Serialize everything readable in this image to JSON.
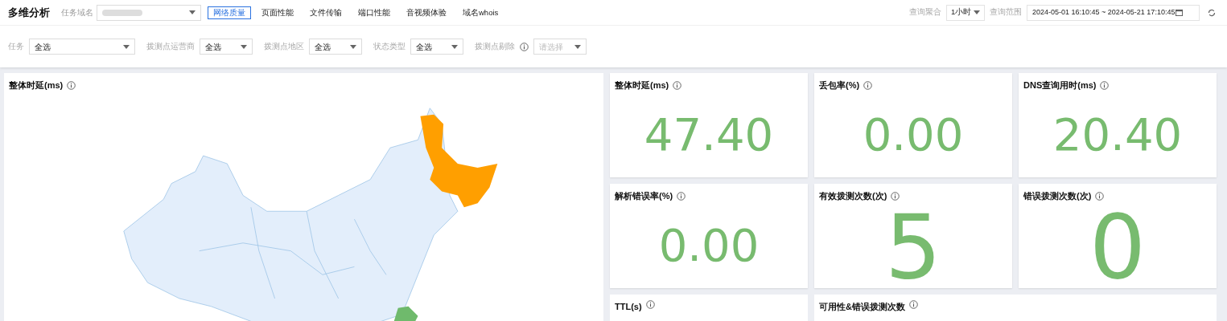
{
  "header": {
    "title": "多维分析",
    "domain_label": "任务域名",
    "tabs": [
      {
        "label": "网络质量",
        "selected": true
      },
      {
        "label": "页面性能",
        "selected": false
      },
      {
        "label": "文件传输",
        "selected": false
      },
      {
        "label": "端口性能",
        "selected": false
      },
      {
        "label": "音视频体验",
        "selected": false
      },
      {
        "label": "域名whois",
        "selected": false
      }
    ],
    "aggregate_label": "查询聚合",
    "aggregate_value": "1小时",
    "range_label": "查询范围",
    "range_value": "2024-05-01 16:10:45 ~ 2024-05-21 17:10:45"
  },
  "filters": [
    {
      "label": "任务",
      "value": "全选",
      "info": false
    },
    {
      "label": "拨测点运营商",
      "value": "全选",
      "info": false
    },
    {
      "label": "拨测点地区",
      "value": "全选",
      "info": false
    },
    {
      "label": "状态类型",
      "value": "全选",
      "info": false
    },
    {
      "label": "拨测点剔除",
      "placeholder": "请选择",
      "info": true
    }
  ],
  "map_card": {
    "title": "整体时延(ms)",
    "highlighted_regions": [
      {
        "color": "#ff9f00"
      },
      {
        "color": "#6fba6c"
      }
    ]
  },
  "metrics": [
    {
      "title": "整体时延(ms)",
      "value": "47.40"
    },
    {
      "title": "丢包率(%)",
      "value": "0.00"
    },
    {
      "title": "DNS查询用时(ms)",
      "value": "20.40"
    },
    {
      "title": "解析错误率(%)",
      "value": "0.00"
    },
    {
      "title": "有效拨测次数(次)",
      "value": "5"
    },
    {
      "title": "错误拨测次数(次)",
      "value": "0"
    }
  ],
  "bottom_cards": [
    {
      "title": "TTL(s)"
    },
    {
      "title": "可用性&错误拨测次数"
    }
  ]
}
